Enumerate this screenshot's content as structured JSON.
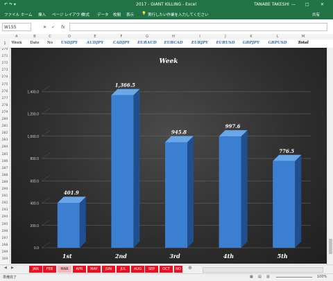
{
  "title": {
    "quick_access": "↶ ↷ ▾",
    "window": "2017 - GIANT KILLING - Excel",
    "user": "TANABE TAKESHI"
  },
  "ribbon": {
    "tabs": [
      "ファイル",
      "ホーム",
      "挿入",
      "ページ レイアウト",
      "数式",
      "データ",
      "校閲",
      "表示"
    ],
    "tell_me": "実行したい作業を入力してください",
    "share": "共有"
  },
  "formula_bar": {
    "name_box": "W155",
    "fx": "fx",
    "cancel": "✕",
    "enter": "✓"
  },
  "columns": [
    "A",
    "B",
    "C",
    "D",
    "E",
    "F",
    "G",
    "H",
    "I",
    "J",
    "K",
    "L",
    "M"
  ],
  "header_row": {
    "row_number": "1",
    "cells": [
      "Week",
      "Date",
      "No",
      "USDJPY",
      "AUDJPY",
      "CADJPY",
      "EURAUD",
      "EURCAD",
      "EURJPY",
      "EURUSD",
      "GBPJPY",
      "GBPUSD",
      "Total"
    ]
  },
  "row_numbers": [
    "270",
    "271",
    "272",
    "273",
    "274",
    "275",
    "276",
    "277",
    "278",
    "279",
    "280",
    "281",
    "282",
    "283",
    "284",
    "285",
    "286",
    "287",
    "288",
    "289",
    "290",
    "291",
    "292",
    "293",
    "294",
    "295",
    "296",
    "297",
    "298",
    "299",
    "300"
  ],
  "chart_data": {
    "type": "bar",
    "title": "Week",
    "categories": [
      "1st",
      "2nd",
      "3rd",
      "4th",
      "5th"
    ],
    "values": [
      401.9,
      1366.5,
      945.8,
      997.6,
      776.5
    ],
    "value_labels": [
      "401.9",
      "1,366.5",
      "945.8",
      "997.6",
      "776.5"
    ],
    "ylim": [
      0,
      1600
    ],
    "yticks": [
      "0.0",
      "200.0",
      "400.0",
      "600.0",
      "800.0",
      "1,000.0",
      "1,200.0",
      "1,400.0"
    ],
    "ytick_values": [
      0,
      200,
      400,
      600,
      800,
      1000,
      1200,
      1400
    ],
    "grid": true,
    "xlabel": "",
    "ylabel": "",
    "colors": {
      "bar": "#3a7fd0",
      "bar_side": "#1f4f8f",
      "bar_top": "#6aa7e8"
    }
  },
  "sheet_tabs": [
    "JAN",
    "FEB",
    "MAR",
    "APR",
    "MAY",
    "JUN",
    "JUL",
    "AUG",
    "SEP",
    "OCT",
    "NO"
  ],
  "active_tab": "MAR",
  "status": {
    "ready": "準備完了",
    "zoom": "100%"
  }
}
